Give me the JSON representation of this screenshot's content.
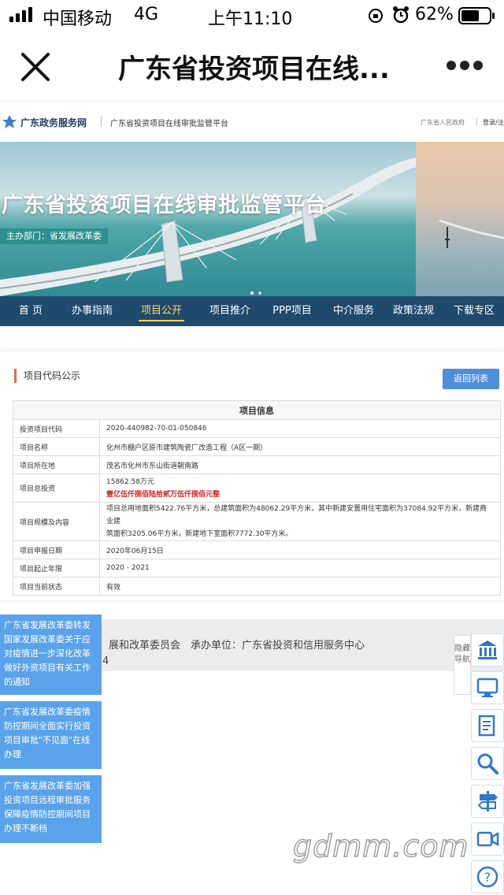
{
  "status_bar": {
    "carrier": "中国移动",
    "network": "4G",
    "time": "上午11:10",
    "battery": "62%"
  },
  "nav_bar": {
    "title": "广东省投资项目在线..."
  },
  "site_header": {
    "logo_text": "广东政务服务网",
    "platform_name": "广东省投资项目在线审批监管平台",
    "right_link": "广东省人民政府",
    "login": "登录/注"
  },
  "banner": {
    "title": "广东省投资项目在线审批监管平台",
    "subtitle": "主办部门：省发展改革委"
  },
  "main_nav": {
    "items": [
      "首 页",
      "办事指南",
      "项目公开",
      "项目推介",
      "PPP项目",
      "中介服务",
      "政策法规",
      "下载专区"
    ],
    "active_index": 2
  },
  "section": {
    "title": "项目代码公示",
    "back_button": "返回列表",
    "table_header": "项目信息",
    "rows": [
      {
        "label": "投资项目代码",
        "value": "2020-440982-70-01-050846"
      },
      {
        "label": "项目名称",
        "value": "化州市棚户区原市建筑陶瓷厂改造工程（A区一期）"
      },
      {
        "label": "项目所在地",
        "value": "茂名市化州市东山街道朝南路"
      },
      {
        "label": "项目总投资",
        "value": "15862.58万元",
        "value2": "壹亿伍仟捌佰陆拾贰万伍仟捌佰元整"
      },
      {
        "label": "项目规模及内容",
        "value": "项目总用地面积5422.76平方米，总建筑面积为48062.29平方米，其中新建安置用住宅面积为37084.92平方米，新建商业建",
        "value2": "筑面积3205.06平方米，新建地下室面积7772.30平方米。"
      },
      {
        "label": "项目申报日期",
        "value": "2020年06月15日"
      },
      {
        "label": "项目起止年限",
        "value": "2020 - 2021"
      },
      {
        "label": "项目当前状态",
        "value": "有效"
      }
    ]
  },
  "footer": {
    "text": "展和改革委员会　承办单位：广东省投资和信用服务中心",
    "text2": "4"
  },
  "notices": [
    "广东省发展改革委转发国家发展改革委关于应对疫情进一步深化改革做好外资项目有关工作的通知",
    "广东省发展改革委疫情防控期间全面实行投资项目审批\"不见面\"在线办理",
    "广东省发展改革委加强投资项目远程审批服务保障疫情防控期间项目办理不断档"
  ],
  "float_nav": {
    "label": "隐藏导航",
    "buttons": [
      "bank-icon",
      "monitor-icon",
      "document-icon",
      "search-icon",
      "signpost-icon",
      "video-icon",
      "help-icon"
    ]
  },
  "watermark": "gdmm.com",
  "colors": {
    "nav_blue": "#1e4a6e",
    "active_yellow": "#ffd666",
    "button_blue": "#4f8ed9",
    "notice_blue": "#5aa3ea",
    "red_text": "#d02020"
  }
}
